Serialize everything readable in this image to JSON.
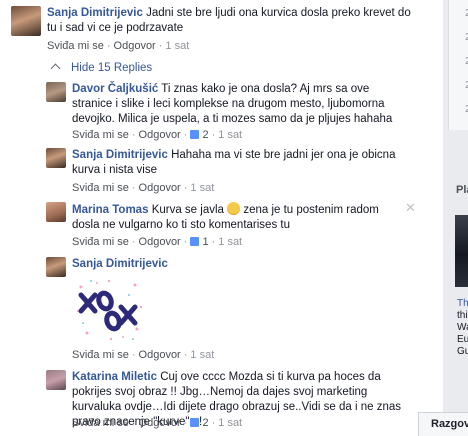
{
  "comments": [
    {
      "author": "Sanja Dimitrijevic",
      "text": "Jadni ste bre ljudi ona kurvica dosla preko krevet do tu i sad vi ce je podrzavate",
      "like": "Sviđa mi se",
      "reply": "Odgovor",
      "time": "1 sat"
    }
  ],
  "hide_replies": "Hide 15 Replies",
  "replies": [
    {
      "author": "Davor Čaljkušić",
      "text": "Ti znas kako je ona dosla? Aj mrs sa ove stranice i slike i leci komplekse na drugom mesto, ljubomorna devojko. Milica je uspela, a ti mozes samo da je pljujes hahaha",
      "like": "Sviđa mi se",
      "reply": "Odgovor",
      "likes": "2",
      "time": "1 sat"
    },
    {
      "author": "Sanja Dimitrijevic",
      "text": "Hahaha ma vi ste bre jadni jer ona je obicna kurva i nista vise",
      "like": "Sviđa mi se",
      "reply": "Odgovor",
      "time": "1 sat"
    },
    {
      "author": "Marina Tomas",
      "text_before": "Kurva se javla",
      "text_after": "zena je tu postenim radom dosla ne vulgarno ko ti sto komentarises tu",
      "like": "Sviđa mi se",
      "reply": "Odgovor",
      "likes": "1",
      "time": "1 sat"
    },
    {
      "author": "Sanja Dimitrijevic",
      "sticker": "XOXO",
      "like": "Sviđa mi se",
      "reply": "Odgovor",
      "time": "1 sat"
    },
    {
      "author": "Katarina Miletic",
      "text": "Cuj ove cccc Mozda si ti kurva pa hoces da pokrijes svoj obraz !! Jbg…Nemoj da dajes svoj marketing kurvaluka ovdje…Idi dijete drago obrazuj se..Vidi se da i ne znas pravo znacenje \"kurve\" ..!",
      "like": "Sviđa mi se",
      "reply": "Odgovor",
      "likes": "2",
      "time": "1 sat"
    }
  ],
  "right_rail": {
    "numbers": [
      "2",
      "2",
      "2",
      "2",
      "2"
    ],
    "section_label": "Pla",
    "snippet": [
      "Thi",
      "this",
      "Wa",
      "Eu",
      "Gu"
    ]
  },
  "chat_tab": "Razgov",
  "colors": {
    "link": "#365899",
    "meta": "#90949c",
    "like_blue": "#5890ff"
  }
}
